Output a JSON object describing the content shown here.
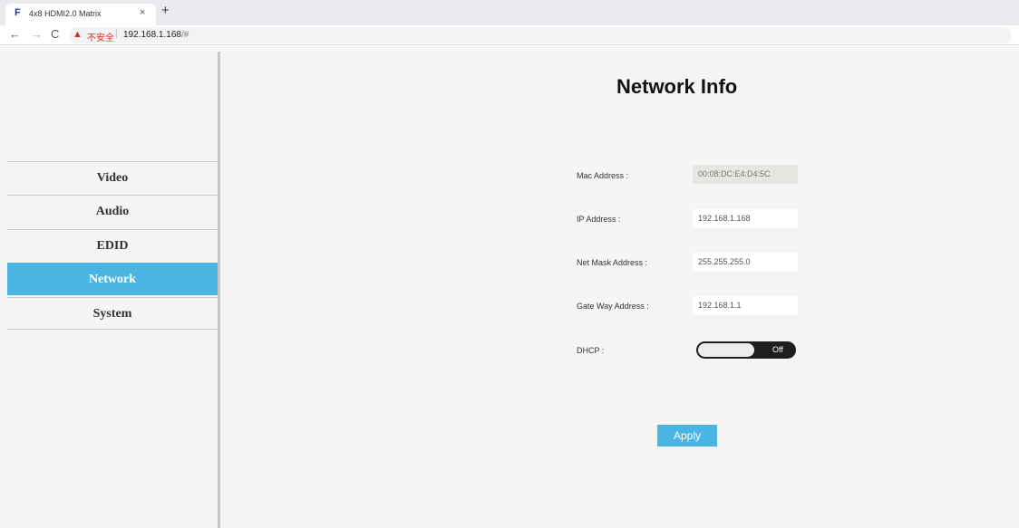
{
  "browser": {
    "tab_favicon": "F",
    "tab_title": "4x8 HDMI2.0 Matrix",
    "tab_close": "×",
    "new_tab": "+",
    "nav_back": "←",
    "nav_forward": "→",
    "nav_reload": "C",
    "security_icon": "▲",
    "security_text": "不安全",
    "url_separator": "|",
    "url_host": "192.168.1.168",
    "url_path": "/#"
  },
  "sidebar": {
    "items": [
      {
        "label": "Video"
      },
      {
        "label": "Audio"
      },
      {
        "label": "EDID"
      },
      {
        "label": "Network",
        "active": true
      },
      {
        "label": "System"
      }
    ]
  },
  "main": {
    "title": "Network Info",
    "fields": {
      "mac": {
        "label": "Mac Address :",
        "value": "00:08:DC:E4:D4:5C"
      },
      "ip": {
        "label": "IP Address :",
        "value": "192.168.1.168"
      },
      "netmask": {
        "label": "Net Mask Address :",
        "value": "255.255.255.0"
      },
      "gateway": {
        "label": "Gate Way Address :",
        "value": "192.168.1.1"
      }
    },
    "dhcp": {
      "label": "DHCP :",
      "state": "Off"
    },
    "apply_label": "Apply"
  },
  "colors": {
    "accent": "#4ab5e3",
    "toggle_track": "#1e1e1e",
    "background": "#f5f5f5"
  }
}
